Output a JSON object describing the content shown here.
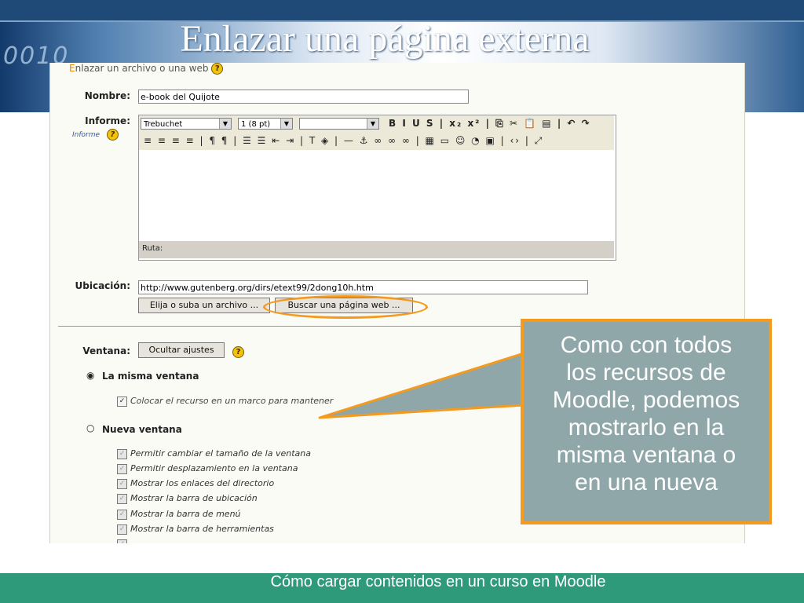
{
  "slide": {
    "title": "Enlazar una página externa",
    "footer": "Cómo cargar contenidos en un curso en Moodle",
    "banner_deco": "0010"
  },
  "form": {
    "section_first_letter": "E",
    "section_rest": "nlazar un archivo o una web",
    "help_glyph": "?",
    "nombre_label": "Nombre:",
    "nombre_value": "e-book del Quijote",
    "informe_label": "Informe:",
    "informe_sublabel": "Informe",
    "editor": {
      "font_select": "Trebuchet",
      "size_select": "1 (8 pt)",
      "style_select": "",
      "toolbar1_icons": "B  I  U  S  | x₂ x² | ⎘ ✂ 📋 ▤ | ↶ ↷",
      "toolbar2_icons": "≡ ≡ ≡ ≡ | ¶ ¶ | ☰ ☰ ⇤ ⇥ | T ◈ | — ⚓ ∞ ∞ ∞ | ▦ ▭ ☺ ◔ ▣ | ‹› | ⤢",
      "path_label": "Ruta:"
    },
    "ubicacion_label": "Ubicación:",
    "ubicacion_value": "http://www.gutenberg.org/dirs/etext99/2dong10h.htm",
    "btn_elija": "Elija o suba un archivo ...",
    "btn_buscar": "Buscar una página web ...",
    "ventana_label": "Ventana:",
    "btn_ocultar": "Ocultar ajustes",
    "radio_misma": "La misma ventana",
    "radio_nueva": "Nueva ventana",
    "cb_marco": "Colocar el recurso en un marco para mantener",
    "new_window_options": [
      "Permitir cambiar el tamaño de la ventana",
      "Permitir desplazamiento en la ventana",
      "Mostrar los enlaces del directorio",
      "Mostrar la barra de ubicación",
      "Mostrar la barra de menú",
      "Mostrar la barra de herramientas",
      ""
    ]
  },
  "callout": {
    "text_lines": [
      "Como con todos",
      "los recursos de",
      "Moodle, podemos",
      "mostrarlo en la",
      "misma ventana o",
      "en una nueva"
    ]
  },
  "colors": {
    "accent_orange": "#f39a1f",
    "callout_bg": "#8fa7a8",
    "footer_bg": "#2f9a7a",
    "header_blue": "#1f4a78"
  }
}
